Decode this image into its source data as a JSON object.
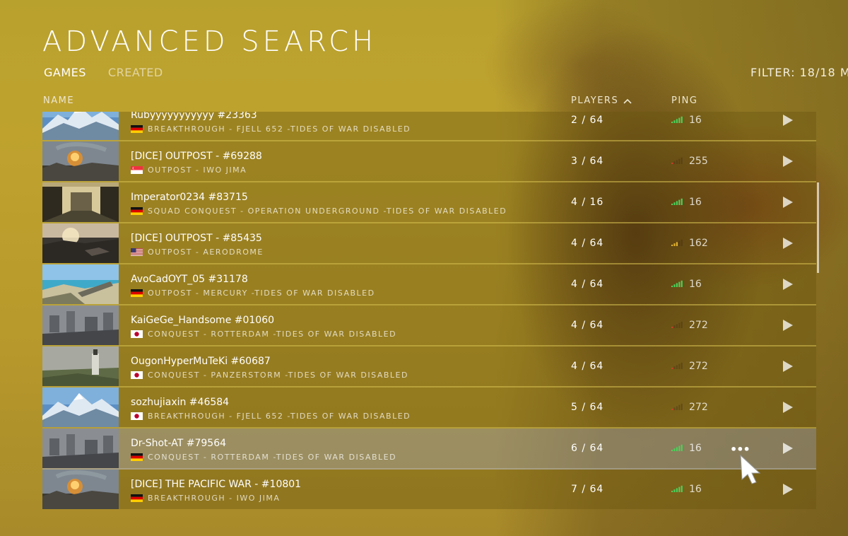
{
  "title": "ADVANCED SEARCH",
  "tabs": {
    "games": "GAMES",
    "created": "CREATED"
  },
  "filter_text": "FILTER: 18/18 M",
  "columns": {
    "name": "NAME",
    "players": "PLAYERS",
    "ping": "PING"
  },
  "colors": {
    "ping_good": "#4cd05a",
    "ping_medium": "#e0b030",
    "ping_bad": "#d23a2a"
  },
  "servers": [
    {
      "name": "Rubyyyyyyyyyyy #23363",
      "flag": "de",
      "details": "BREAKTHROUGH - FJELL 652 -TIDES OF WAR DISABLED",
      "players": "2 / 64",
      "ping": "16",
      "ping_quality": "good",
      "thumb": "snow"
    },
    {
      "name": "[DICE] OUTPOST - #69288",
      "flag": "sg",
      "details": "OUTPOST - IWO JIMA",
      "players": "3 / 64",
      "ping": "255",
      "ping_quality": "bad",
      "thumb": "iwo"
    },
    {
      "name": "Imperator0234 #83715",
      "flag": "de",
      "details": "SQUAD CONQUEST - OPERATION UNDERGROUND -TIDES OF WAR DISABLED",
      "players": "4 / 16",
      "ping": "16",
      "ping_quality": "good",
      "thumb": "tunnel"
    },
    {
      "name": "[DICE] OUTPOST - #85435",
      "flag": "us",
      "details": "OUTPOST - AERODROME",
      "players": "4 / 64",
      "ping": "162",
      "ping_quality": "medium",
      "thumb": "aero"
    },
    {
      "name": "AvoCadOYT_05 #31178",
      "flag": "de",
      "details": "OUTPOST - MERCURY -TIDES OF WAR DISABLED",
      "players": "4 / 64",
      "ping": "16",
      "ping_quality": "good",
      "thumb": "mercury"
    },
    {
      "name": "KaiGeGe_Handsome #01060",
      "flag": "jp",
      "details": "CONQUEST - ROTTERDAM -TIDES OF WAR DISABLED",
      "players": "4 / 64",
      "ping": "272",
      "ping_quality": "bad",
      "thumb": "rotterdam"
    },
    {
      "name": "OugonHyperMuTeKi #60687",
      "flag": "jp",
      "details": "CONQUEST - PANZERSTORM -TIDES OF WAR DISABLED",
      "players": "4 / 64",
      "ping": "272",
      "ping_quality": "bad",
      "thumb": "panzer"
    },
    {
      "name": "sozhujiaxin #46584",
      "flag": "jp",
      "details": "BREAKTHROUGH - FJELL 652 -TIDES OF WAR DISABLED",
      "players": "5 / 64",
      "ping": "272",
      "ping_quality": "bad",
      "thumb": "snow"
    },
    {
      "name": "Dr-Shot-AT #79564",
      "flag": "de",
      "details": "CONQUEST - ROTTERDAM -TIDES OF WAR DISABLED",
      "players": "6 / 64",
      "ping": "16",
      "ping_quality": "good",
      "thumb": "rotterdam",
      "hover": true
    },
    {
      "name": "[DICE] THE PACIFIC WAR - #10801",
      "flag": "de",
      "details": "BREAKTHROUGH - IWO JIMA",
      "players": "7 / 64",
      "ping": "16",
      "ping_quality": "good",
      "thumb": "iwo"
    }
  ]
}
